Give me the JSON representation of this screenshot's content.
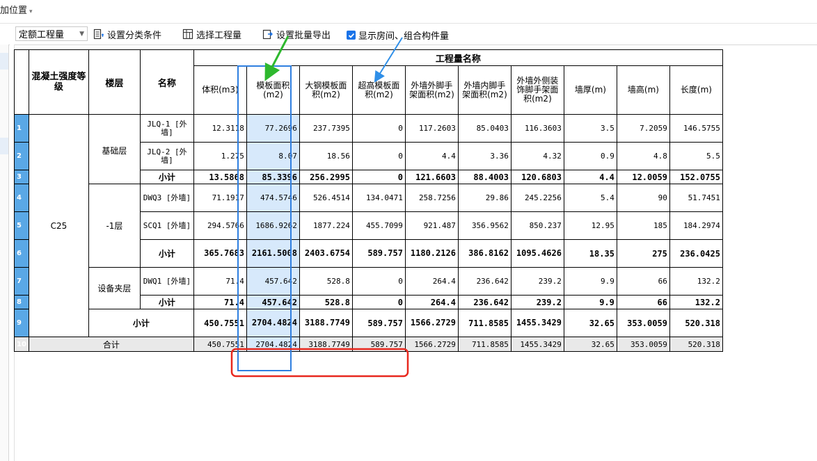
{
  "topbar": {
    "position_label": "加位置",
    "caret": "▾"
  },
  "toolbar": {
    "quota_select": "定额工程量",
    "set_category_conditions": "设置分类条件",
    "select_quantities": "选择工程量",
    "batch_export": "设置批量导出",
    "show_rooms_checkbox": "显示房间、组合构件量",
    "show_rooms_checked": true
  },
  "table": {
    "header_group": "工程量名称",
    "col_grade": "混凝土强度等级",
    "col_floor": "楼层",
    "col_name": "名称",
    "columns": [
      "体积(m3)",
      "模板面积(m2)",
      "大钢模板面积(m2)",
      "超高模板面积(m2)",
      "外墙外脚手架面积(m2)",
      "外墙内脚手架面积(m2)",
      "外墙外侧装饰脚手架面积(m2)",
      "墙厚(m)",
      "墙高(m)",
      "长度(m)"
    ],
    "grade": "C25",
    "floors": {
      "f1": "基础层",
      "f2": "-1层",
      "f3": "设备夹层"
    },
    "subtotal_label": "小计",
    "total_label": "合计",
    "rows": [
      {
        "n": "1",
        "name": "JLQ-1 [外墙]",
        "v": [
          "12.3118",
          "77.2696",
          "237.7395",
          "0",
          "117.2603",
          "85.0403",
          "116.3603",
          "3.5",
          "7.2059",
          "146.5755"
        ]
      },
      {
        "n": "2",
        "name": "JLQ-2 [外墙]",
        "v": [
          "1.275",
          "8.07",
          "18.56",
          "0",
          "4.4",
          "3.36",
          "4.32",
          "0.9",
          "4.8",
          "5.5"
        ]
      },
      {
        "n": "3",
        "name": "小计",
        "v": [
          "13.5868",
          "85.3396",
          "256.2995",
          "0",
          "121.6603",
          "88.4003",
          "120.6803",
          "4.4",
          "12.0059",
          "152.0755"
        ]
      },
      {
        "n": "4",
        "name": "DWQ3 [外墙]",
        "v": [
          "71.1917",
          "474.5746",
          "526.4514",
          "134.0471",
          "258.7256",
          "29.86",
          "245.2256",
          "5.4",
          "90",
          "51.7451"
        ]
      },
      {
        "n": "5",
        "name": "SCQ1 [外墙]",
        "v": [
          "294.5766",
          "1686.9262",
          "1877.224",
          "455.7099",
          "921.487",
          "356.9562",
          "850.237",
          "12.95",
          "185",
          "184.2974"
        ]
      },
      {
        "n": "6",
        "name": "小计",
        "v": [
          "365.7683",
          "2161.5008",
          "2403.6754",
          "589.757",
          "1180.2126",
          "386.8162",
          "1095.4626",
          "18.35",
          "275",
          "236.0425"
        ]
      },
      {
        "n": "7",
        "name": "DWQ1 [外墙]",
        "v": [
          "71.4",
          "457.642",
          "528.8",
          "0",
          "264.4",
          "236.642",
          "239.2",
          "9.9",
          "66",
          "132.2"
        ]
      },
      {
        "n": "8",
        "name": "小计",
        "v": [
          "71.4",
          "457.642",
          "528.8",
          "0",
          "264.4",
          "236.642",
          "239.2",
          "9.9",
          "66",
          "132.2"
        ]
      },
      {
        "n": "9",
        "name": "小计",
        "v": [
          "450.7551",
          "2704.4824",
          "3188.7749",
          "589.757",
          "1566.2729",
          "711.8585",
          "1455.3429",
          "32.65",
          "353.0059",
          "520.318"
        ]
      },
      {
        "n": "10",
        "name": "合计",
        "v": [
          "450.7551",
          "2704.4824",
          "3188.7749",
          "589.757",
          "1566.2729",
          "711.8585",
          "1455.3429",
          "32.65",
          "353.0059",
          "520.318"
        ]
      }
    ]
  },
  "annotations": {
    "arrow_green_color": "#2eb82e",
    "arrow_blue_color": "#2f8fe8",
    "column_box_color": "#2f7fe0",
    "total_box_color": "#e8281e"
  }
}
